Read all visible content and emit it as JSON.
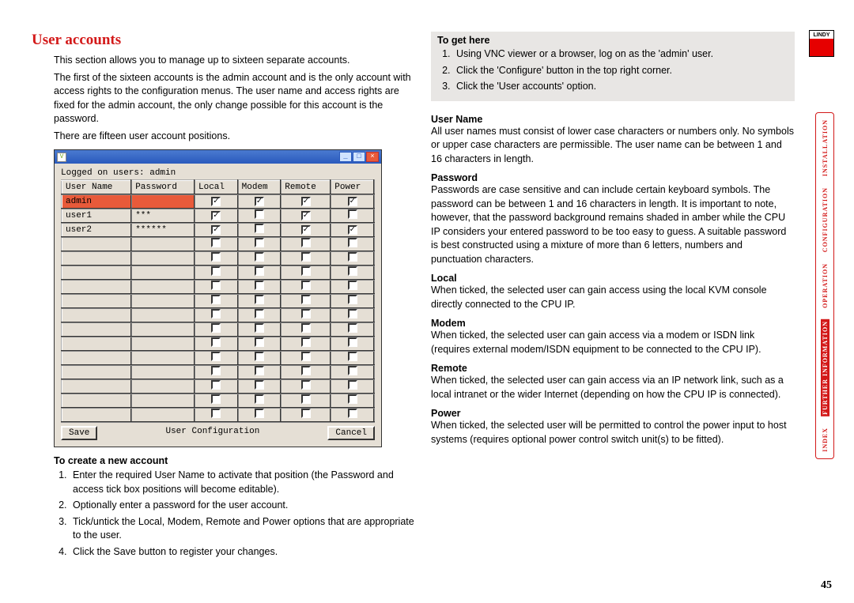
{
  "title": "User accounts",
  "intro": [
    "This section allows you to manage up to sixteen separate accounts.",
    "The first of the sixteen accounts is the admin account and is the only account with access rights to the configuration menus. The user name and access rights are fixed for the admin account, the only change possible for this account is the password.",
    "There are fifteen user account positions."
  ],
  "screenshot": {
    "logged": "Logged on users: admin",
    "headers": [
      "User Name",
      "Password",
      "Local",
      "Modem",
      "Remote",
      "Power"
    ],
    "rows": [
      {
        "name": "admin",
        "pass": "",
        "local": true,
        "modem": true,
        "remote": true,
        "power": true,
        "admin": true
      },
      {
        "name": "user1",
        "pass": "***",
        "local": true,
        "modem": false,
        "remote": true,
        "power": false,
        "admin": false
      },
      {
        "name": "user2",
        "pass": "******",
        "local": true,
        "modem": false,
        "remote": true,
        "power": true,
        "admin": false
      },
      {
        "name": "",
        "pass": "",
        "local": false,
        "modem": false,
        "remote": false,
        "power": false
      },
      {
        "name": "",
        "pass": "",
        "local": false,
        "modem": false,
        "remote": false,
        "power": false
      },
      {
        "name": "",
        "pass": "",
        "local": false,
        "modem": false,
        "remote": false,
        "power": false
      },
      {
        "name": "",
        "pass": "",
        "local": false,
        "modem": false,
        "remote": false,
        "power": false
      },
      {
        "name": "",
        "pass": "",
        "local": false,
        "modem": false,
        "remote": false,
        "power": false
      },
      {
        "name": "",
        "pass": "",
        "local": false,
        "modem": false,
        "remote": false,
        "power": false
      },
      {
        "name": "",
        "pass": "",
        "local": false,
        "modem": false,
        "remote": false,
        "power": false
      },
      {
        "name": "",
        "pass": "",
        "local": false,
        "modem": false,
        "remote": false,
        "power": false
      },
      {
        "name": "",
        "pass": "",
        "local": false,
        "modem": false,
        "remote": false,
        "power": false
      },
      {
        "name": "",
        "pass": "",
        "local": false,
        "modem": false,
        "remote": false,
        "power": false
      },
      {
        "name": "",
        "pass": "",
        "local": false,
        "modem": false,
        "remote": false,
        "power": false
      },
      {
        "name": "",
        "pass": "",
        "local": false,
        "modem": false,
        "remote": false,
        "power": false
      },
      {
        "name": "",
        "pass": "",
        "local": false,
        "modem": false,
        "remote": false,
        "power": false
      }
    ],
    "save_label": "Save",
    "dialog_title": "User Configuration",
    "cancel_label": "Cancel"
  },
  "create_head": "To create a new account",
  "create_steps": [
    "Enter the required User Name to activate that position (the Password and access tick box positions will become editable).",
    "Optionally enter a password for the user account.",
    "Tick/untick the Local, Modem, Remote and Power options that are appropriate to the user.",
    "Click the Save button to register your changes."
  ],
  "to_get_here": {
    "head": "To get here",
    "steps": [
      "Using VNC viewer or a browser, log on as the 'admin' user.",
      "Click the 'Configure' button in the top right corner.",
      "Click the 'User accounts' option."
    ]
  },
  "definitions": [
    {
      "head": "User Name",
      "body": "All user names must consist of lower case characters or numbers only. No symbols or upper case characters are permissible. The user name can be between 1 and 16 characters in length."
    },
    {
      "head": "Password",
      "body": "Passwords are case sensitive and can include certain keyboard symbols. The password can be between 1 and 16 characters in length. It is important to note, however, that the password background remains shaded in amber while the CPU IP considers your entered password to be too easy to guess. A suitable password is best constructed using a mixture of more than 6 letters, numbers and punctuation characters."
    },
    {
      "head": "Local",
      "body": "When ticked, the selected user can gain access using the local KVM console directly connected to the CPU IP."
    },
    {
      "head": "Modem",
      "body": "When ticked, the selected user can gain access via a modem or ISDN link (requires external modem/ISDN equipment to be connected to the CPU IP)."
    },
    {
      "head": "Remote",
      "body": "When ticked, the selected user can gain access via an IP network link, such as a local intranet or the wider Internet (depending on how the CPU IP is connected)."
    },
    {
      "head": "Power",
      "body": "When ticked, the selected user will be permitted to control the power input to host systems (requires optional power control switch unit(s) to be fitted)."
    }
  ],
  "sidebar": {
    "logo": "LINDY",
    "items": [
      "INSTALLATION",
      "CONFIGURATION",
      "OPERATION",
      "FURTHER INFORMATION",
      "INDEX"
    ],
    "active": "FURTHER INFORMATION"
  },
  "page_number": "45"
}
